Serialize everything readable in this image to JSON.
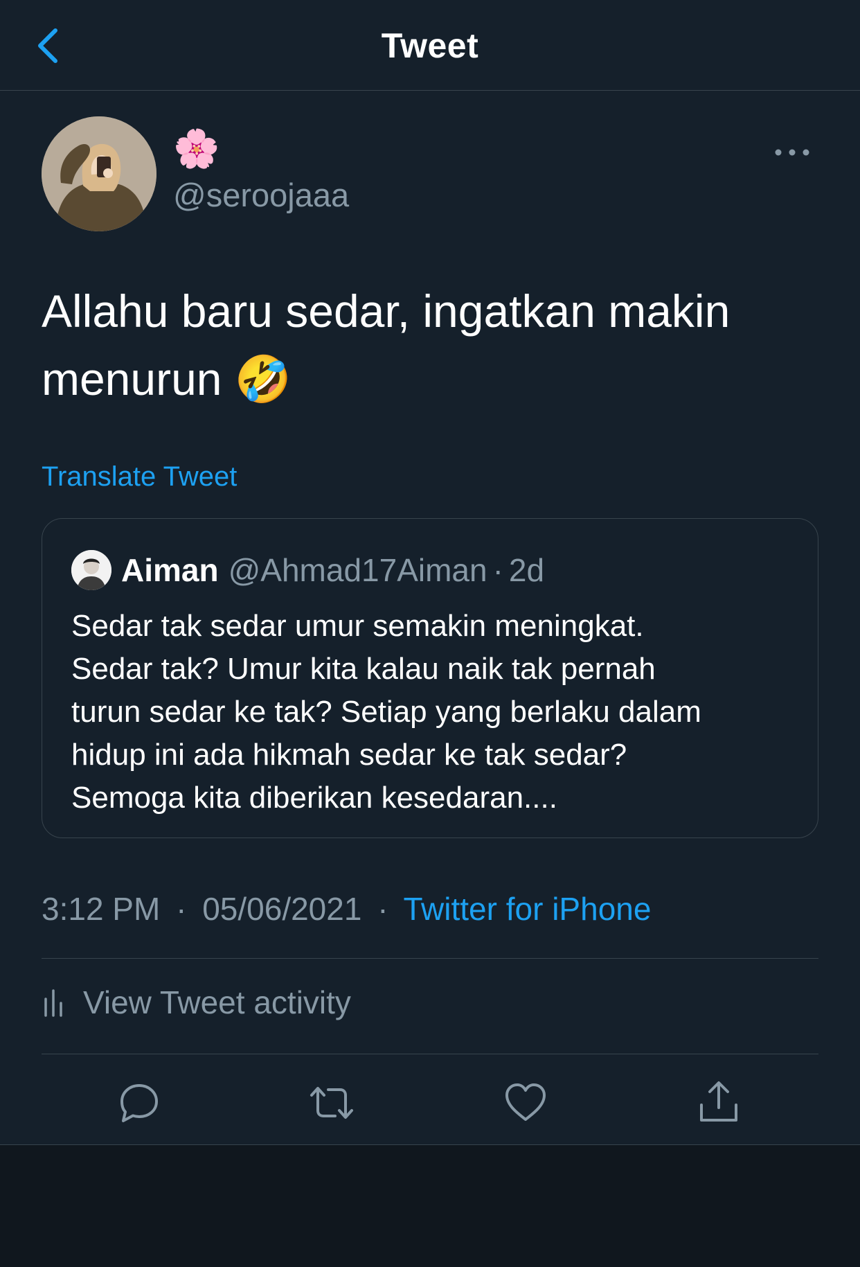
{
  "header": {
    "title": "Tweet",
    "back_icon": "chevron-left-icon"
  },
  "colors": {
    "background": "#15202b",
    "accent": "#1da1f2",
    "secondary_text": "#8899a6",
    "border": "#38444d"
  },
  "tweet": {
    "author": {
      "display_name": "🌸",
      "handle": "@seroojaaa"
    },
    "text_lines": [
      "Allahu baru sedar, ingatkan makin",
      "menurun 🤣"
    ],
    "translate_label": "Translate Tweet",
    "quoted": {
      "name": "Aiman",
      "handle": "@Ahmad17Aiman",
      "dot": "·",
      "time": "2d",
      "text_lines": [
        "Sedar tak sedar umur semakin meningkat.",
        "Sedar tak? Umur kita kalau naik tak pernah",
        "turun sedar ke tak? Setiap yang berlaku dalam",
        "hidup ini ada hikmah sedar ke tak sedar?",
        "Semoga kita diberikan kesedaran...."
      ]
    },
    "meta": {
      "time": "3:12 PM",
      "separator": "·",
      "date": "05/06/2021",
      "source": "Twitter for iPhone"
    },
    "activity_label": "View Tweet activity"
  },
  "actions": [
    {
      "icon": "reply-icon"
    },
    {
      "icon": "retweet-icon"
    },
    {
      "icon": "like-icon"
    },
    {
      "icon": "share-icon"
    }
  ]
}
